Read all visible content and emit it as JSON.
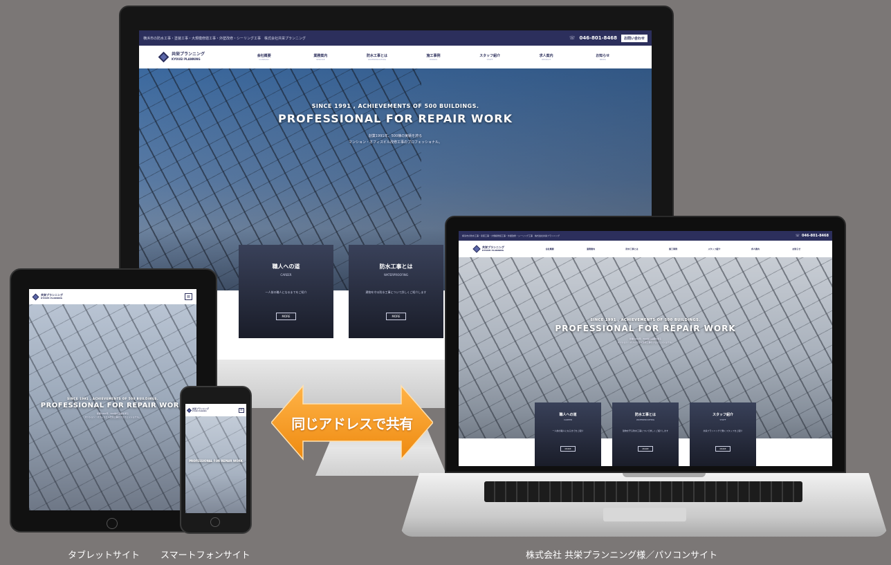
{
  "site": {
    "topbar_text": "横浜市の防水工事・塗装工事・大規模修繕工事・外壁改修・シーリング工事　株式会社共栄プランニング",
    "phone": "046-801-8468",
    "contact_label": "お問い合わせ",
    "logo_jp": "共栄プランニング",
    "logo_en": "KYOUEI PLANNING",
    "nav": [
      {
        "label": "会社概要",
        "sub": "COMPANY"
      },
      {
        "label": "業務案内",
        "sub": "SERVICE"
      },
      {
        "label": "防水工事とは",
        "sub": "WATERPROOFING"
      },
      {
        "label": "施工事例",
        "sub": "WORKS"
      },
      {
        "label": "スタッフ紹介",
        "sub": "STAFF"
      },
      {
        "label": "求人案内",
        "sub": "RECRUIT"
      },
      {
        "label": "お知らせ",
        "sub": "NEWS"
      }
    ],
    "hero_small": "SINCE 1991 , ACHIEVEMENTS OF 500 BUILDINGS.",
    "hero_big": "PROFESSIONAL FOR REPAIR WORK",
    "hero_jp_1": "創業1991年、500棟の実績を誇る",
    "hero_jp_2": "マンション・オフィスビル改修工事のプロフェッショナル。",
    "cards": [
      {
        "title": "職人への道",
        "sub": "CAREER",
        "text": "一人前の職人になるまでをご紹介",
        "button": "MORE"
      },
      {
        "title": "防水工事とは",
        "sub": "WATERPROOFING",
        "text": "建物を守る防水工事について詳しくご紹介します",
        "button": "MORE"
      },
      {
        "title": "スタッフ紹介",
        "sub": "STAFF",
        "text": "共栄プランニングで働くスタッフをご紹介",
        "button": "MORE"
      }
    ]
  },
  "arrow_label": "同じアドレスで共有",
  "captions": {
    "tablet": "タブレットサイト",
    "phone": "スマートフォンサイト",
    "pc": "株式会社 共栄プランニング様／パソコンサイト"
  },
  "colors": {
    "background": "#7b7776",
    "brand_navy": "#2c2f5c",
    "arrow_orange": "#f39a1e"
  }
}
